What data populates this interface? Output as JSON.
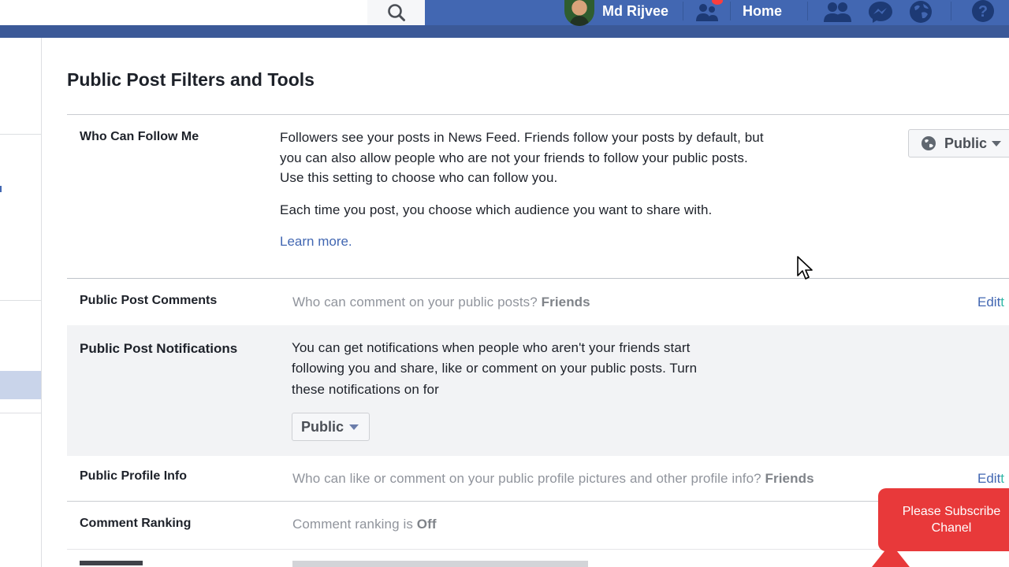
{
  "topbar": {
    "user_name": "Md Rijvee",
    "home_label": "Home",
    "icons": [
      "search-icon",
      "friend-requests-icon",
      "messenger-icon",
      "globe-notifications-icon",
      "help-icon"
    ]
  },
  "page": {
    "title": "Public Post Filters and Tools"
  },
  "follow": {
    "label": "Who Can Follow Me",
    "line1": "Followers see your posts in News Feed. Friends follow your posts by default, but",
    "line2": "you can also allow people who are not your friends to follow your public posts.",
    "line3": "Use this setting to choose who can follow you.",
    "line4": "Each time you post, you choose which audience you want to share with.",
    "learn_more": "Learn more.",
    "audience": "Public"
  },
  "comments": {
    "label": "Public Post Comments",
    "question": "Who can comment on your public posts?",
    "value": "Friends",
    "edit": "Edit",
    "edit_tail": "t"
  },
  "notifications": {
    "label": "Public Post Notifications",
    "line1": "You can get notifications when people who aren't your friends start",
    "line2": "following you and share, like or comment on your public posts. Turn",
    "line3": "these notifications on for",
    "select_value": "Public"
  },
  "profile_info": {
    "label": "Public Profile Info",
    "question": "Who can like or comment on your public profile pictures and other profile info?",
    "value": "Friends",
    "edit": "Edit",
    "edit_tail": "t"
  },
  "ranking": {
    "label": "Comment Ranking",
    "text": "Comment ranking is",
    "value": "Off"
  },
  "overlay": {
    "line1": "Please Subscribe",
    "line2": "Chanel"
  },
  "colors": {
    "brand": "#4267b2",
    "subscribe": "#e8393a"
  }
}
